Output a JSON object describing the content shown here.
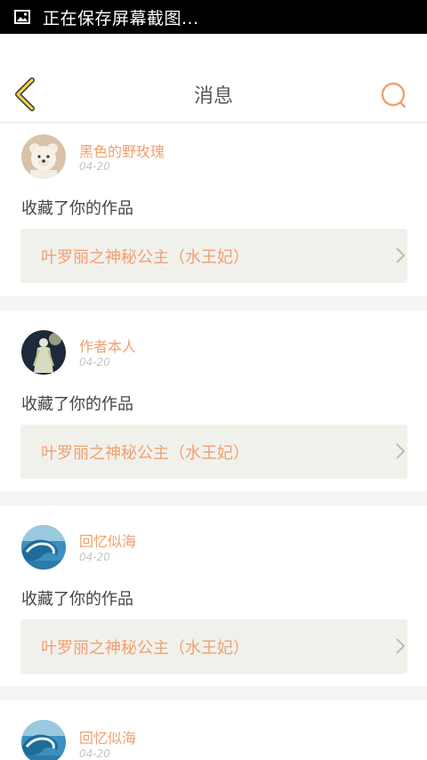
{
  "status_bar": {
    "text": "正在保存屏幕截图...",
    "icon": "image-icon"
  },
  "header": {
    "title": "消息",
    "back_icon": "chevron-left-icon",
    "search_icon": "search-icon",
    "accent_color": "#F5D54A",
    "search_color": "#F0A070"
  },
  "notifications": [
    {
      "user": "黑色的野玫瑰",
      "time": "04-20",
      "action": "收藏了你的作品",
      "work_title": "叶罗丽之神秘公主（水王妃）",
      "avatar": "teddy-bear-avatar"
    },
    {
      "user": "作者本人",
      "time": "04-20",
      "action": "收藏了你的作品",
      "work_title": "叶罗丽之神秘公主（水王妃）",
      "avatar": "fairy-avatar"
    },
    {
      "user": "回忆似海",
      "time": "04-20",
      "action": "收藏了你的作品",
      "work_title": "叶罗丽之神秘公主（水王妃）",
      "avatar": "ocean-wave-avatar"
    },
    {
      "user": "回忆似海",
      "time": "04-20",
      "avatar": "ocean-wave-avatar"
    }
  ]
}
